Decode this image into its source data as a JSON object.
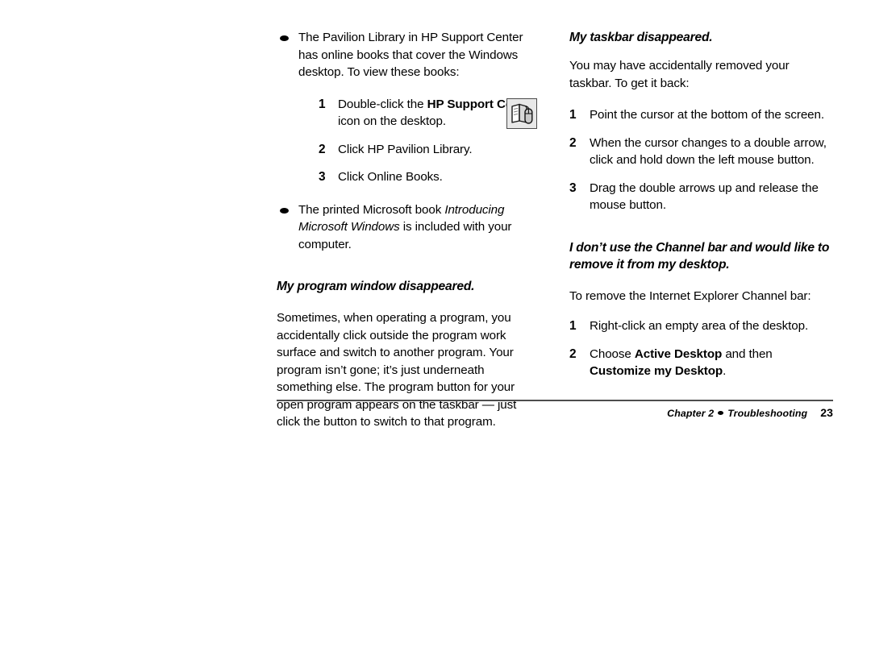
{
  "page": {
    "number": "23",
    "chapter_label": "Chapter 2",
    "chapter_title": "Troubleshooting",
    "background_color": "#ffffff",
    "text_color": "#000000",
    "rule_color": "#4d4d4d"
  },
  "left_column": {
    "bullet_1": {
      "text": "The Pavilion Library in HP Support Center has online books that cover the Windows desktop. To view these books:",
      "steps": [
        {
          "number": "1",
          "text_before": "Double-click the ",
          "text_bold": "HP Support Center",
          "text_after": " icon on the desktop."
        },
        {
          "number": "2",
          "text_before": "Click HP Pavilion Library.",
          "text_bold": "",
          "text_after": ""
        },
        {
          "number": "3",
          "text_before": "Click Online Books.",
          "text_bold": "",
          "text_after": ""
        }
      ],
      "icon": {
        "name": "hp-support-center-icon",
        "description": "open book with computer mouse",
        "background_color": "#e8e8e8",
        "border_color": "#4a4a4a"
      }
    },
    "bullet_2": {
      "text_before": "The printed Microsoft book ",
      "text_italic": "Introducing Microsoft Windows",
      "text_after": " is included with your computer."
    },
    "section": {
      "heading": "My program window disappeared.",
      "body": "Sometimes, when operating a program, you accidentally click outside the program work surface and switch to another program. Your program isn’t gone; it’s just underneath something else. The program button for your open program appears on the taskbar — just click the button to switch to that program."
    }
  },
  "right_column": {
    "section_taskbar": {
      "heading": "My taskbar disappeared.",
      "body": "You may have accidentally removed your taskbar. To get it back:",
      "steps": [
        {
          "number": "1",
          "text": "Point the cursor at the bottom of the screen."
        },
        {
          "number": "2",
          "text": "When the cursor changes to a double arrow, click and hold down the left mouse button."
        },
        {
          "number": "3",
          "text": "Drag the double arrows up and release the mouse button."
        }
      ]
    },
    "section_channel_bar": {
      "heading": "I don’t use the Channel bar and would like to remove it from my desktop.",
      "body": "To remove the Internet Explorer Channel bar:",
      "steps": [
        {
          "number": "1",
          "text_before": "Right-click an empty area of the desktop.",
          "bold_1": "",
          "text_middle": "",
          "bold_2": "",
          "text_after": ""
        },
        {
          "number": "2",
          "text_before": "Choose ",
          "bold_1": "Active Desktop",
          "text_middle": " and then ",
          "bold_2": "Customize my Desktop",
          "text_after": "."
        }
      ]
    }
  }
}
